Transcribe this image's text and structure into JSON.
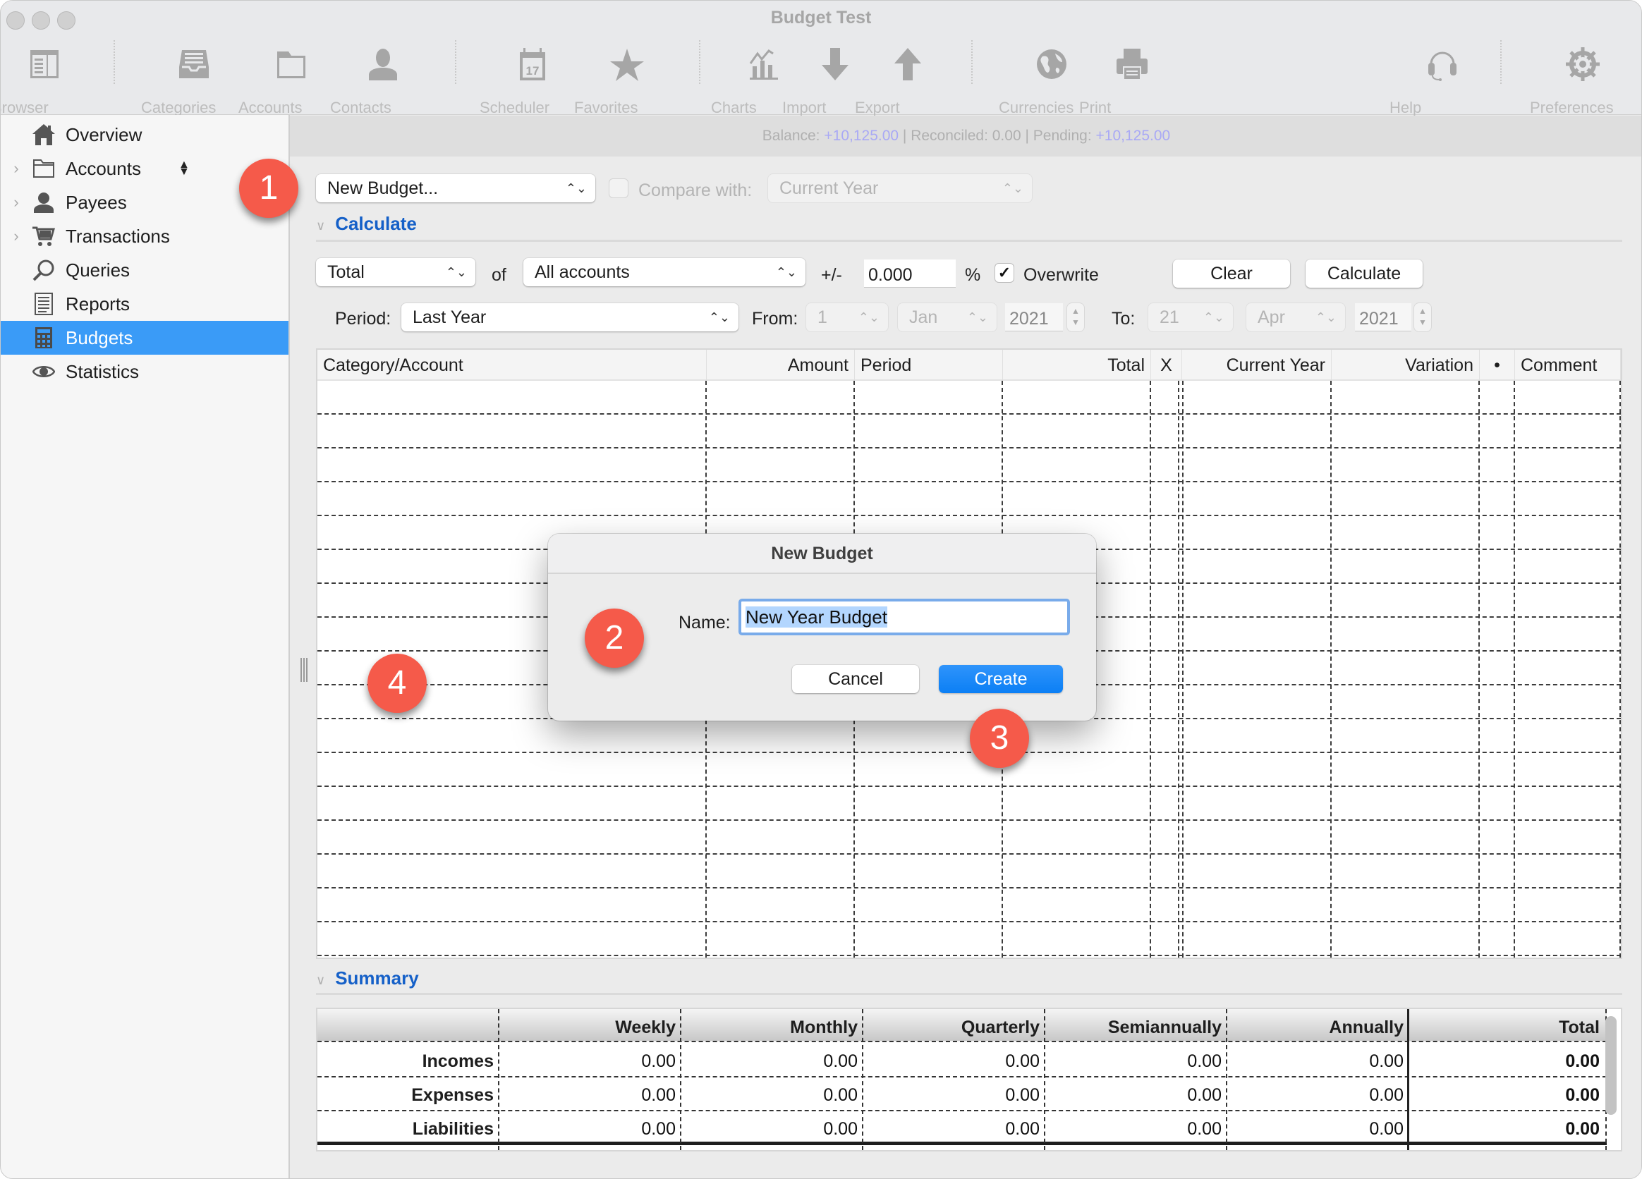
{
  "window": {
    "title": "Budget Test"
  },
  "toolbar": {
    "items": [
      {
        "label": "Browser",
        "icon": "browser-icon"
      },
      {
        "label": "Categories",
        "icon": "inbox-tray-icon"
      },
      {
        "label": "Accounts",
        "icon": "folder-icon"
      },
      {
        "label": "Contacts",
        "icon": "person-icon"
      },
      {
        "label": "Scheduler",
        "icon": "calendar-icon",
        "icon_text": "17"
      },
      {
        "label": "Favorites",
        "icon": "star-icon"
      },
      {
        "label": "Charts",
        "icon": "chart-icon"
      },
      {
        "label": "Import",
        "icon": "arrow-down-icon"
      },
      {
        "label": "Export",
        "icon": "arrow-up-icon"
      },
      {
        "label": "Currencies",
        "icon": "globe-icon"
      },
      {
        "label": "Print",
        "icon": "printer-icon"
      },
      {
        "label": "Help",
        "icon": "headset-icon"
      },
      {
        "label": "Preferences",
        "icon": "gear-icon"
      }
    ]
  },
  "sidebar": {
    "items": [
      {
        "label": "Overview",
        "icon": "house-icon",
        "expandable": false,
        "selected": false
      },
      {
        "label": "Accounts",
        "icon": "folder-icon",
        "expandable": true,
        "selected": false,
        "sort_icon": "updown-arrows-icon"
      },
      {
        "label": "Payees",
        "icon": "person-icon",
        "expandable": true,
        "selected": false
      },
      {
        "label": "Transactions",
        "icon": "cart-icon",
        "expandable": true,
        "selected": false
      },
      {
        "label": "Queries",
        "icon": "magnifier-icon",
        "expandable": false,
        "selected": false
      },
      {
        "label": "Reports",
        "icon": "document-icon",
        "expandable": false,
        "selected": false
      },
      {
        "label": "Budgets",
        "icon": "calculator-icon",
        "expandable": false,
        "selected": true
      },
      {
        "label": "Statistics",
        "icon": "eye-icon",
        "expandable": false,
        "selected": false
      }
    ]
  },
  "balance_bar": {
    "balance_label": "Balance:",
    "balance_value": "+10,125.00",
    "reconciled_label": "| Reconciled: 0.00 |",
    "pending_label": "Pending:",
    "pending_value": "+10,125.00"
  },
  "budget_controls": {
    "budget_select": "New Budget...",
    "compare_checked": false,
    "compare_label": "Compare with:",
    "compare_select": "Current Year"
  },
  "calculate": {
    "section_title": "Calculate",
    "mode_select": "Total",
    "of_label": "of",
    "accounts_select": "All accounts",
    "plusminus_label": "+/-",
    "percent_value": "0.000",
    "percent_label": "%",
    "overwrite_checked": true,
    "overwrite_label": "Overwrite",
    "clear_button": "Clear",
    "calculate_button": "Calculate",
    "period_label": "Period:",
    "period_select": "Last Year",
    "from_label": "From:",
    "from_day": "1",
    "from_month": "Jan",
    "from_year": "2021",
    "to_label": "To:",
    "to_day": "21",
    "to_month": "Apr",
    "to_year": "2021"
  },
  "budget_table": {
    "columns": [
      "Category/Account",
      "Amount",
      "Period",
      "Total",
      "X",
      "Current Year",
      "Variation",
      "•",
      "Comment"
    ],
    "rows": []
  },
  "dialog": {
    "title": "New Budget",
    "name_label": "Name:",
    "name_value": "New Year Budget",
    "cancel_button": "Cancel",
    "create_button": "Create"
  },
  "summary": {
    "section_title": "Summary",
    "columns": [
      "",
      "Weekly",
      "Monthly",
      "Quarterly",
      "Semiannually",
      "Annually",
      "Total"
    ],
    "rows": [
      {
        "label": "Incomes",
        "values": [
          "0.00",
          "0.00",
          "0.00",
          "0.00",
          "0.00",
          "0.00"
        ]
      },
      {
        "label": "Expenses",
        "values": [
          "0.00",
          "0.00",
          "0.00",
          "0.00",
          "0.00",
          "0.00"
        ]
      },
      {
        "label": "Liabilities",
        "values": [
          "0.00",
          "0.00",
          "0.00",
          "0.00",
          "0.00",
          "0.00"
        ]
      }
    ]
  },
  "callouts": [
    "1",
    "2",
    "3",
    "4"
  ],
  "colors": {
    "accent": "#3a9bf7",
    "section_title": "#1560c8",
    "callout": "#f55a4a",
    "balance_positive": "#a9a9f5",
    "create_button": "#0b7ff5"
  }
}
